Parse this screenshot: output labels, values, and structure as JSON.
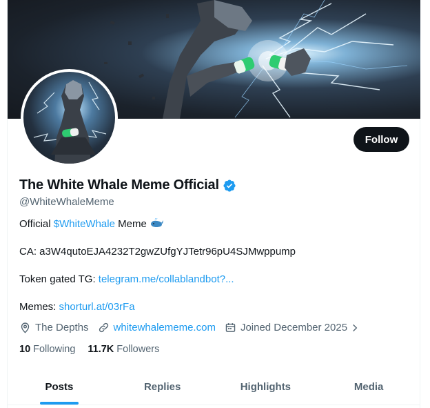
{
  "profile": {
    "display_name": "The White Whale Meme Official",
    "handle": "@WhiteWhaleMeme",
    "follow_label": "Follow",
    "bio": {
      "prefix": "Official ",
      "cashtag": "$WhiteWhale",
      "suffix": " Meme",
      "ca_line": "CA: a3W4qutoEJA4232T2gwZUfgYJTetr96pU4SJMwppump",
      "token_label": "Token gated TG: ",
      "token_link": "telegram.me/collablandbot?...",
      "memes_label": "Memes: ",
      "memes_link": "shorturl.at/03rFa"
    },
    "location": "The Depths",
    "website": "whitewhalememe.com",
    "joined": "Joined December 2025",
    "following_count": "10",
    "following_label": "Following",
    "followers_count": "11.7K",
    "followers_label": "Followers"
  },
  "tabs": [
    {
      "label": "Posts",
      "active": true
    },
    {
      "label": "Replies",
      "active": false
    },
    {
      "label": "Highlights",
      "active": false
    },
    {
      "label": "Media",
      "active": false
    }
  ],
  "colors": {
    "accent": "#1d9bf0",
    "text_primary": "#0f1419",
    "text_secondary": "#536471",
    "button_bg": "#0f1419",
    "verified": "#1d9bf0"
  },
  "icons": {
    "verified": "verified-badge-icon",
    "location": "location-pin-icon",
    "website": "link-icon",
    "joined": "calendar-icon",
    "joined_more": "chevron-right-icon",
    "whale": "whale-emoji-icon"
  }
}
